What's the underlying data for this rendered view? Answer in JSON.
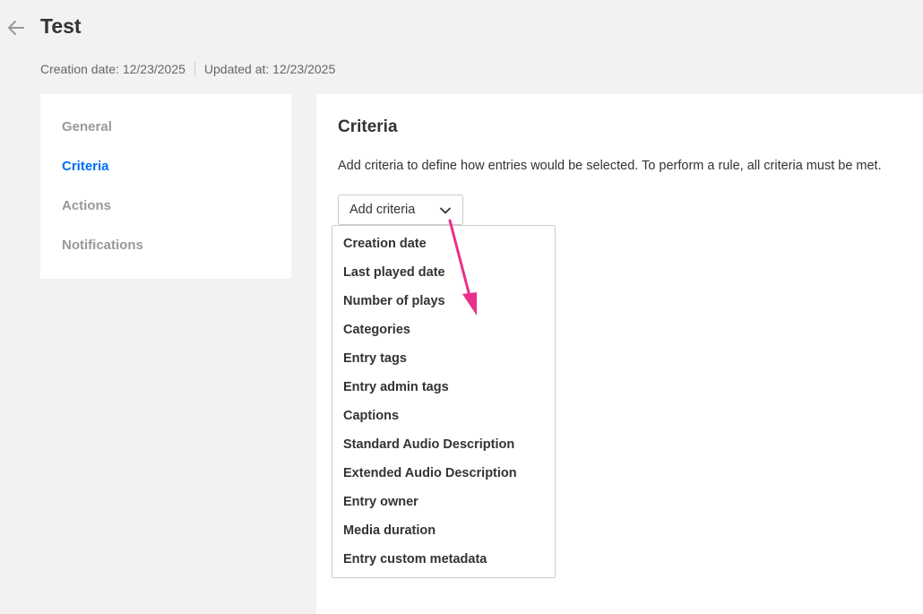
{
  "header": {
    "title": "Test",
    "creation_date": "Creation date: 12/23/2025",
    "updated_at": "Updated at: 12/23/2025"
  },
  "sidebar": {
    "items": [
      {
        "label": "General",
        "active": false
      },
      {
        "label": "Criteria",
        "active": true
      },
      {
        "label": "Actions",
        "active": false
      },
      {
        "label": "Notifications",
        "active": false
      }
    ]
  },
  "main": {
    "section_title": "Criteria",
    "description": "Add criteria to define how entries would be selected. To perform a rule, all criteria must be met.",
    "add_criteria_label": "Add criteria",
    "menu_items": [
      "Creation date",
      "Last played date",
      "Number of plays",
      "Categories",
      "Entry tags",
      "Entry admin tags",
      "Captions",
      "Standard Audio Description",
      "Extended Audio Description",
      "Entry owner",
      "Media duration",
      "Entry custom metadata"
    ]
  },
  "colors": {
    "accent": "#006efa",
    "annotation_arrow": "#e8308a",
    "background": "#f2f2f2"
  },
  "icons": {
    "back": "arrow-left-icon",
    "dropdown": "chevron-down-icon"
  }
}
